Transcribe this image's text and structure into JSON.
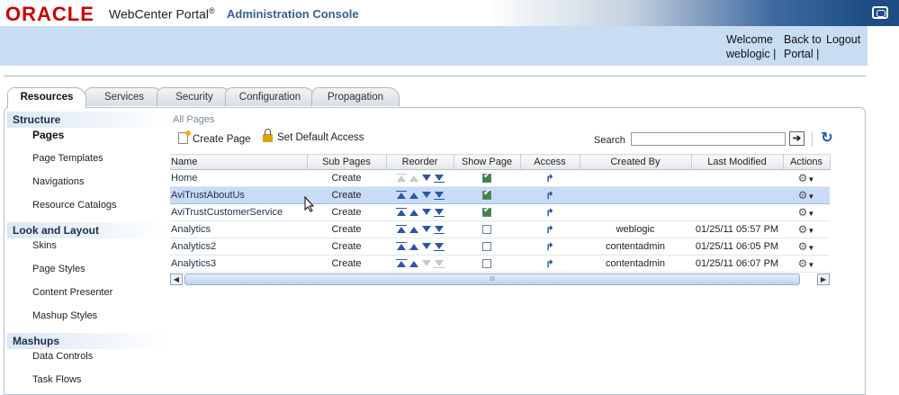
{
  "header": {
    "logo": "ORACLE",
    "product": "WebCenter Portal",
    "product_mark": "®",
    "console": "Administration Console"
  },
  "userbar": {
    "welcome": "Welcome",
    "user": "weblogic",
    "sep1": "|",
    "back_to_1": "Back to",
    "back_to_2": "Portal",
    "sep2": "|",
    "logout": "Logout"
  },
  "tabs": [
    {
      "label": "Resources",
      "active": true
    },
    {
      "label": "Services"
    },
    {
      "label": "Security"
    },
    {
      "label": "Configuration"
    },
    {
      "label": "Propagation"
    }
  ],
  "nav": {
    "structure": {
      "title": "Structure",
      "items": [
        "Pages",
        "Page Templates",
        "Navigations",
        "Resource Catalogs"
      ]
    },
    "look": {
      "title": "Look and Layout",
      "items": [
        "Skins",
        "Page Styles",
        "Content Presenter",
        "Mashup Styles"
      ]
    },
    "mashups": {
      "title": "Mashups",
      "items": [
        "Data Controls",
        "Task Flows"
      ]
    }
  },
  "main": {
    "breadcrumb": "All Pages",
    "create_page": "Create Page",
    "set_default_access": "Set Default Access",
    "search_label": "Search",
    "search_value": "",
    "columns": [
      "Name",
      "Sub Pages",
      "Reorder",
      "Show Page",
      "Access",
      "Created By",
      "Last Modified",
      "Actions"
    ],
    "rows": [
      {
        "name": "Home",
        "sub": "Create",
        "created_by": "",
        "modified": "",
        "show": true
      },
      {
        "name": "AviTrustAboutUs",
        "sub": "Create",
        "created_by": "",
        "modified": "",
        "show": true,
        "selected": true
      },
      {
        "name": "AviTrustCustomerService",
        "sub": "Create",
        "created_by": "",
        "modified": "",
        "show": true
      },
      {
        "name": "Analytics",
        "sub": "Create",
        "created_by": "weblogic",
        "modified": "01/25/11 05:57 PM",
        "show": false
      },
      {
        "name": "Analytics2",
        "sub": "Create",
        "created_by": "contentadmin",
        "modified": "01/25/11 06:05 PM",
        "show": false
      },
      {
        "name": "Analytics3",
        "sub": "Create",
        "created_by": "contentadmin",
        "modified": "01/25/11 06:07 PM",
        "show": false
      }
    ],
    "scroll_grip": "III"
  },
  "icons": {
    "access": "access-arrow-icon",
    "gear": "gear-icon",
    "refresh": "refresh-icon",
    "go": "go-arrow-icon"
  }
}
